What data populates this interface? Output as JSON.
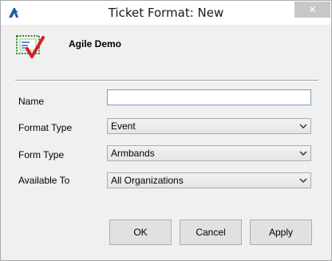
{
  "window": {
    "title": "Ticket Format: New",
    "close_glyph": "✕",
    "app_icon": "app-logo-icon"
  },
  "header": {
    "title": "Agile Demo",
    "icon": "ticket-check-icon"
  },
  "form": {
    "name": {
      "label": "Name",
      "value": ""
    },
    "format_type": {
      "label": "Format Type",
      "value": "Event"
    },
    "form_type": {
      "label": "Form Type",
      "value": "Armbands"
    },
    "available_to": {
      "label": "Available To",
      "value": "All Organizations"
    }
  },
  "buttons": {
    "ok": "OK",
    "cancel": "Cancel",
    "apply": "Apply"
  },
  "colors": {
    "close_button": "#c7c7c7",
    "checkmark": "#d2202a",
    "input_border": "#7a9cc7"
  }
}
